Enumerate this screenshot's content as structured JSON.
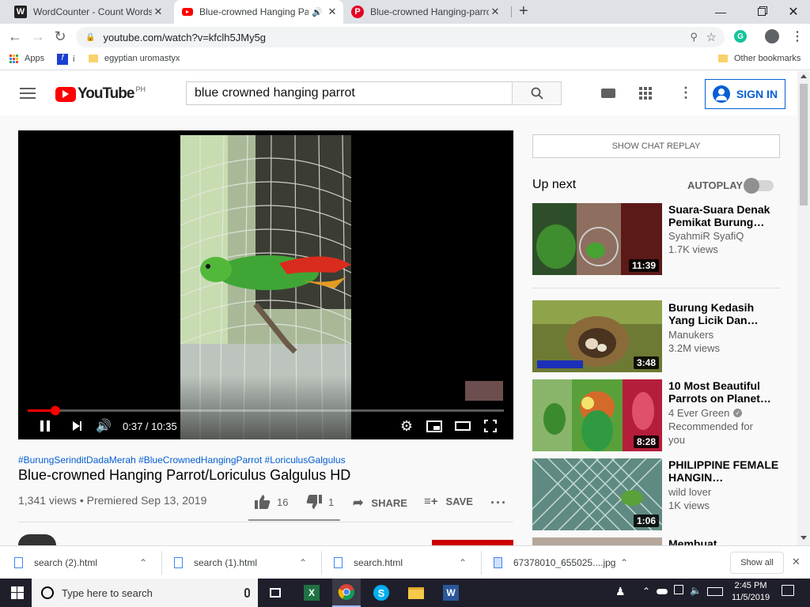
{
  "browser": {
    "tabs": [
      {
        "title": "WordCounter - Count Words & C",
        "favicon": "W"
      },
      {
        "title": "Blue-crowned Hanging Parro",
        "favicon": "yt"
      },
      {
        "title": "Blue-crowned Hanging-parrot Fe",
        "favicon": "P"
      }
    ],
    "new_tab_symbol": "+",
    "url": "youtube.com/watch?v=kfclh5JMy5g",
    "profile_initial": "G",
    "bookmarks": {
      "apps_label": "Apps",
      "item1_label": "i",
      "item2_label": "egyptian uromastyx",
      "other_label": "Other bookmarks"
    }
  },
  "youtube": {
    "logo_text": "YouTube",
    "region": "PH",
    "search_value": "blue crowned hanging parrot",
    "sign_in_label": "SIGN IN",
    "player": {
      "current_time": "0:37",
      "duration": "10:35",
      "progress": 0.058
    },
    "hashtags": "#BurungSerinditDadaMerah #BlueCrownedHangingParrot #LoriculusGalgulus",
    "title": "Blue-crowned Hanging Parrot/Loriculus Galgulus HD",
    "meta": "1,341 views • Premiered Sep 13, 2019",
    "likes": "16",
    "dislikes": "1",
    "share_label": "SHARE",
    "save_label": "SAVE",
    "chat_replay_label": "SHOW CHAT REPLAY",
    "up_next_label": "Up next",
    "autoplay_label": "AUTOPLAY",
    "recommendations": [
      {
        "title": "Suara-Suara Denak Pemikat Burung…",
        "channel": "SyahmiR SyafiQ",
        "views": "1.7K views",
        "extra": "",
        "duration": "11:39"
      },
      {
        "title": "Burung Kedasih Yang Licik Dan…",
        "channel": "Manukers",
        "views": "3.2M views",
        "extra": "",
        "duration": "3:48"
      },
      {
        "title": "10 Most Beautiful Parrots on Planet…",
        "channel": "4 Ever Green",
        "views": "Recommended for",
        "extra": "you",
        "duration": "8:28"
      },
      {
        "title": "PHILIPPINE FEMALE HANGIN…",
        "channel": "wild lover",
        "views": "1K views",
        "extra": "",
        "duration": "1:06"
      },
      {
        "title": "Membuat",
        "channel": "",
        "views": "",
        "extra": "",
        "duration": ""
      }
    ]
  },
  "downloads": {
    "items": [
      "search (2).html",
      "search (1).html",
      "search.html",
      "67378010_655025....jpg"
    ],
    "show_all_label": "Show all"
  },
  "taskbar": {
    "search_placeholder": "Type here to search",
    "time": "2:45 PM",
    "date": "11/5/2019"
  }
}
